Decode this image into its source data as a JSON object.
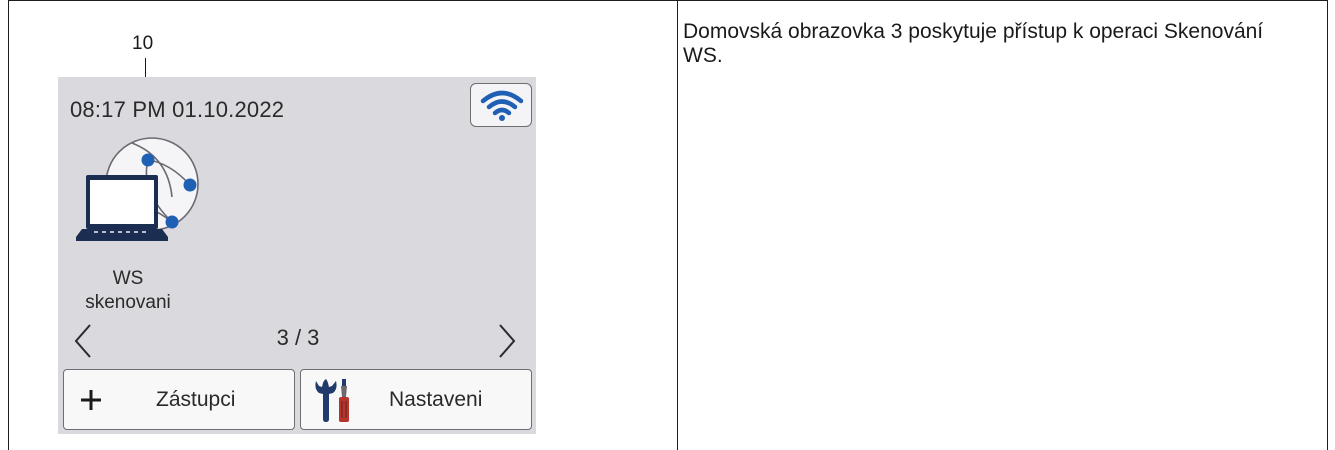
{
  "callout": {
    "number": "10"
  },
  "screen": {
    "datetime": "08:17 PM 01.10.2022",
    "ws_scan": {
      "label_line1": "WS",
      "label_line2": "skenovani"
    },
    "page_indicator": "3 / 3",
    "shortcuts_button": {
      "label": "Zástupci"
    },
    "settings_button": {
      "label": "Nastaveni"
    }
  },
  "description": "Domovská obrazovka 3 poskytuje přístup k operaci Skenování WS.",
  "colors": {
    "accent_blue": "#1f5fb4",
    "screen_bg": "#d9d9de",
    "tool_red": "#b5342c"
  },
  "icons": [
    "wifi-icon",
    "ws-scan-icon",
    "chevron-left-icon",
    "chevron-right-icon",
    "plus-icon",
    "tools-icon"
  ]
}
